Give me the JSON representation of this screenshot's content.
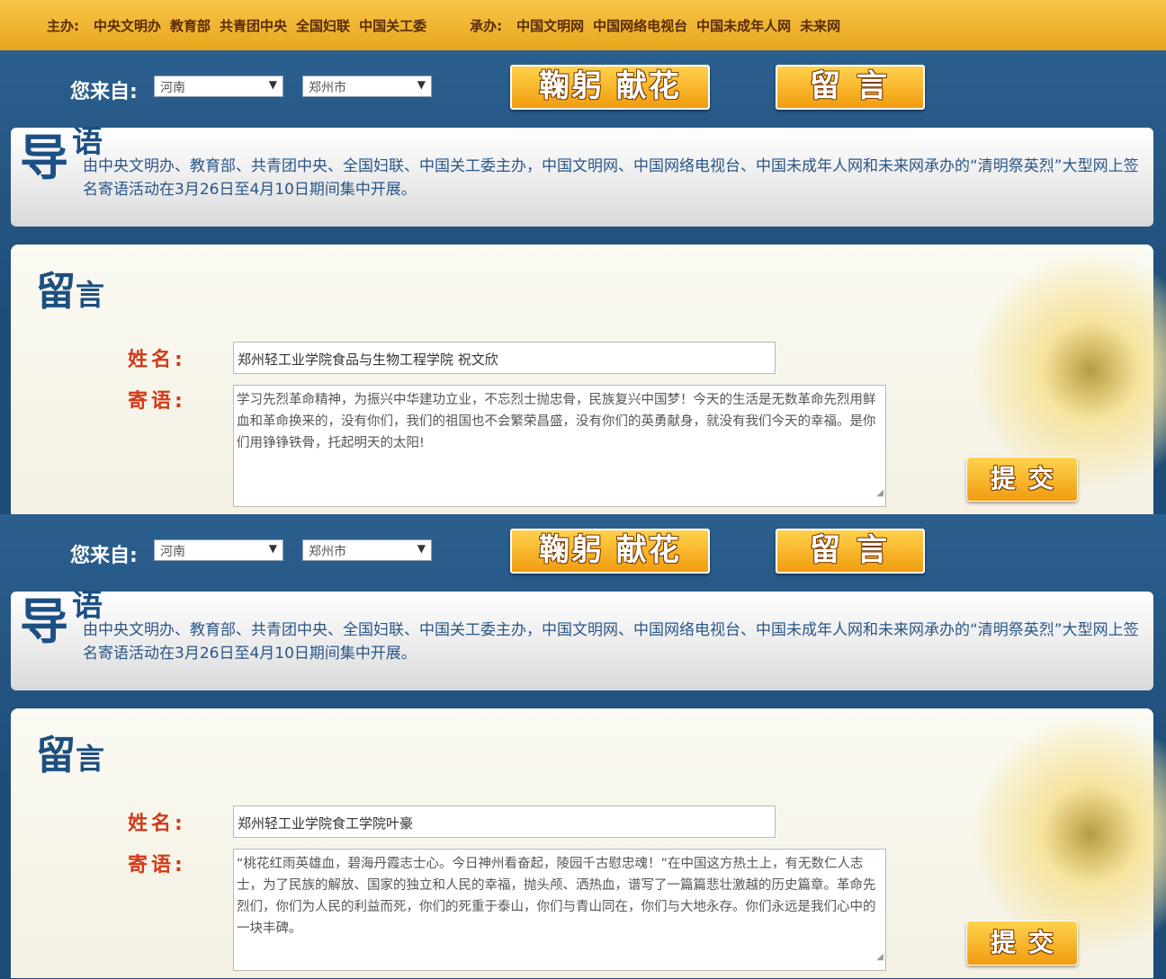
{
  "header": {
    "sponsor_label": "主办:",
    "sponsors": [
      "中央文明办",
      "教育部",
      "共青团中央",
      "全国妇联",
      "中国关工委"
    ],
    "organizer_label": "承办:",
    "organizers": [
      "中国文明网",
      "中国网络电视台",
      "中国未成年人网",
      "未来网"
    ]
  },
  "panels": [
    {
      "origin_label": "您来自:",
      "province": "河南",
      "city": "郑州市",
      "bow_button": "鞠躬 献花",
      "message_button": "留言",
      "intro_title": "导",
      "intro_title_small": "语",
      "intro_text": "由中央文明办、教育部、共青团中央、全国妇联、中国关工委主办，中国文明网、中国网络电视台、中国未成年人网和未来网承办的“清明祭英烈”大型网上签名寄语活动在3月26日至4月10日期间集中开展。",
      "card_title": "留",
      "card_title_small": "言",
      "name_label": "姓名:",
      "name_value": "郑州轻工业学院食品与生物工程学院 祝文欣",
      "message_label": "寄语:",
      "message_value": "学习先烈革命精神，为振兴中华建功立业，不忘烈士抛忠骨，民族复兴中国梦！今天的生活是无数革命先烈用鲜血和革命换来的，没有你们，我们的祖国也不会繁荣昌盛，没有你们的英勇献身，就没有我们今天的幸福。是你们用铮铮铁骨，托起明天的太阳!",
      "submit_button": "提交"
    },
    {
      "origin_label": "您来自:",
      "province": "河南",
      "city": "郑州市",
      "bow_button": "鞠躬 献花",
      "message_button": "留言",
      "intro_title": "导",
      "intro_title_small": "语",
      "intro_text": "由中央文明办、教育部、共青团中央、全国妇联、中国关工委主办，中国文明网、中国网络电视台、中国未成年人网和未来网承办的“清明祭英烈”大型网上签名寄语活动在3月26日至4月10日期间集中开展。",
      "card_title": "留",
      "card_title_small": "言",
      "name_label": "姓名:",
      "name_value": "郑州轻工业学院食工学院叶豪",
      "message_label": "寄语:",
      "message_value": "“桃花红雨英雄血，碧海丹霞志士心。今日神州看奋起，陵园千古慰忠魂！”在中国这方热土上，有无数仁人志士，为了民族的解放、国家的独立和人民的幸福，抛头颅、洒热血，谱写了一篇篇悲壮激越的历史篇章。革命先烈们，你们为人民的利益而死，你们的死重于泰山，你们与青山同在，你们与大地永存。你们永远是我们心中的一块丰碑。",
      "submit_button": "提交"
    }
  ]
}
